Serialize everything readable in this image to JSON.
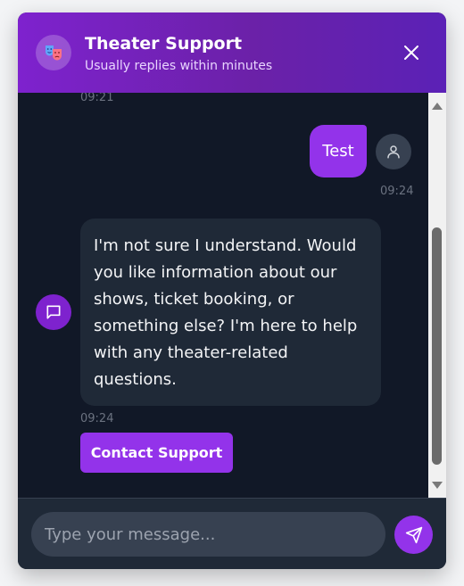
{
  "header": {
    "title": "Theater Support",
    "subtitle": "Usually replies within minutes",
    "avatar_icon": "theater-masks-icon",
    "close_icon": "close-icon"
  },
  "messages": {
    "prev_timestamp": "09:21",
    "user_message": {
      "text": "Test",
      "timestamp": "09:24",
      "avatar_icon": "user-icon"
    },
    "bot_message": {
      "text": "I'm not sure I understand. Would you like information about our shows, ticket booking, or something else? I'm here to help with any theater-related questions.",
      "timestamp": "09:24",
      "avatar_icon": "chat-bubble-icon"
    },
    "contact_button_label": "Contact Support"
  },
  "composer": {
    "placeholder": "Type your message...",
    "value": "",
    "send_icon": "send-icon"
  },
  "colors": {
    "accent": "#9333ea",
    "header_gradient_start": "#7e22ce",
    "header_gradient_end": "#5b21b6",
    "background": "#111827",
    "bot_bubble": "#1f2937"
  }
}
